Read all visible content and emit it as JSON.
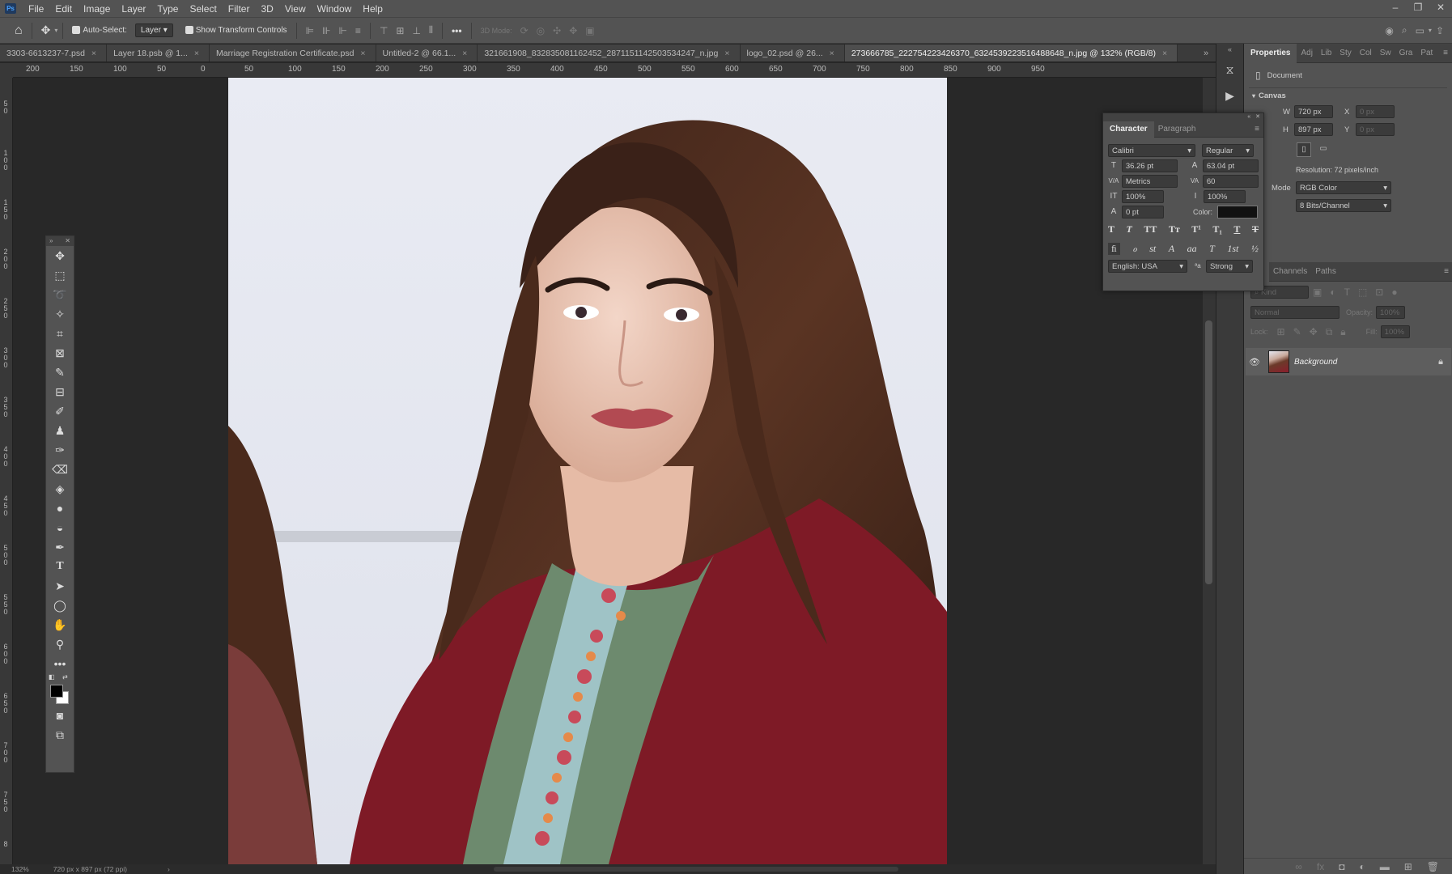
{
  "menu": {
    "app_badge": "Ps",
    "items": [
      "File",
      "Edit",
      "Image",
      "Layer",
      "Type",
      "Select",
      "Filter",
      "3D",
      "View",
      "Window",
      "Help"
    ]
  },
  "window_controls": {
    "minimize": "–",
    "restore": "❐",
    "close": "✕"
  },
  "options_bar": {
    "auto_select_label": "Auto-Select:",
    "auto_select_target": "Layer",
    "show_transform_label": "Show Transform Controls",
    "mode_3d_label": "3D Mode:",
    "more_label": "•••"
  },
  "tabs": [
    {
      "label": "3303-6613237-7.psd",
      "active": false
    },
    {
      "label": "Layer 18.psb @ 1...",
      "active": false
    },
    {
      "label": "Marriage Registration Certificate.psd",
      "active": false
    },
    {
      "label": "Untitled-2 @ 66.1...",
      "active": false
    },
    {
      "label": "321661908_832835081162452_2871151142503534247_n.jpg",
      "active": false
    },
    {
      "label": "logo_02.psd @ 26...",
      "active": false
    },
    {
      "label": "273666785_222754223426370_6324539223516488648_n.jpg @ 132% (RGB/8)",
      "active": true
    }
  ],
  "tab_close": "×",
  "tabs_overflow": "»",
  "ruler": {
    "h_ticks": [
      "200",
      "150",
      "100",
      "50",
      "0",
      "50",
      "100",
      "150",
      "200",
      "250",
      "300",
      "350",
      "400",
      "450",
      "500",
      "550",
      "600",
      "650",
      "700",
      "750",
      "800",
      "850",
      "900",
      "950"
    ],
    "v_ticks": [
      "5 0",
      "1 0 0",
      "1 5 0",
      "2 0 0",
      "2 5 0",
      "3 0 0",
      "3 5 0",
      "4 0 0",
      "4 5 0",
      "5 0 0",
      "5 5 0",
      "6 0 0",
      "6 5 0",
      "7 0 0",
      "7 5 0",
      "8"
    ]
  },
  "toolbar": {
    "header_left": "»",
    "header_right": "✕",
    "more": "•••"
  },
  "status": {
    "zoom": "132%",
    "doc_info": "720 px x 897 px (72 ppi)",
    "arrow": "›"
  },
  "properties": {
    "tabs": [
      "Properties",
      "Adj",
      "Lib",
      "Sty",
      "Col",
      "Sw",
      "Gra",
      "Pat"
    ],
    "document_label": "Document",
    "canvas_label": "Canvas",
    "w_label": "W",
    "w_value": "720 px",
    "h_label": "H",
    "h_value": "897 px",
    "x_label": "X",
    "x_value": "0 px",
    "y_label": "Y",
    "y_value": "0 px",
    "resolution": "Resolution: 72 pixels/inch",
    "mode_label": "Mode",
    "mode_value": "RGB Color",
    "bits_value": "8 Bits/Channel"
  },
  "character": {
    "tabs": [
      "Character",
      "Paragraph"
    ],
    "font_family": "Calibri",
    "font_style": "Regular",
    "font_size": "36.26 pt",
    "leading": "63.04 pt",
    "kerning": "Metrics",
    "tracking": "60",
    "vscale": "100%",
    "hscale": "100%",
    "baseline": "0 pt",
    "color_label": "Color:",
    "color_value": "#111111",
    "glyphs": [
      "T",
      "T",
      "TT",
      "Tт",
      "T¹",
      "T₁",
      "T",
      "T"
    ],
    "ot_glyphs": [
      "ﬁ",
      "ℴ",
      "st",
      "A",
      "aa",
      "T",
      "1st",
      "½"
    ],
    "language": "English: USA",
    "aa_label": "ªa",
    "antialias": "Strong"
  },
  "layers": {
    "tabs": [
      "ers",
      "Channels",
      "Paths"
    ],
    "kind_placeholder": "Kind",
    "blend_mode": "Normal",
    "opacity_label": "Opacity:",
    "opacity_value": "100%",
    "lock_label": "Lock:",
    "fill_label": "Fill:",
    "fill_value": "100%",
    "layer_name": "Background"
  },
  "colors": {
    "foreground": "#000000",
    "background": "#ffffff"
  }
}
